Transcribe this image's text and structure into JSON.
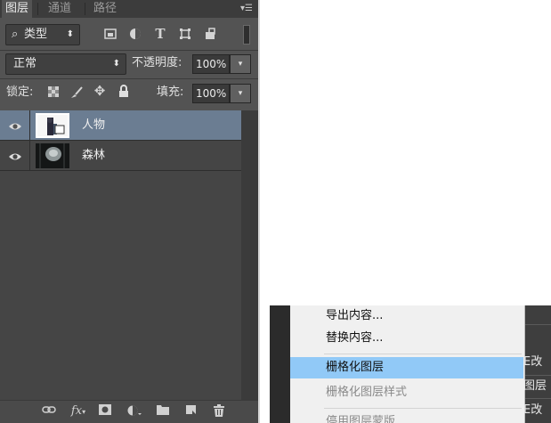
{
  "layers_panel": {
    "tabs": [
      "图层",
      "通道",
      "路径"
    ],
    "menu_icon": "panel-menu-icon",
    "filter": {
      "label": "类型",
      "icon": "search-icon"
    },
    "filter_icons": [
      "image-filter-icon",
      "adjustment-filter-icon",
      "type-filter-icon",
      "shape-filter-icon",
      "smart-object-filter-icon"
    ],
    "blend_mode": "正常",
    "opacity": {
      "label": "不透明度:",
      "value": "100%"
    },
    "lock": {
      "label": "锁定:",
      "icons": [
        "lock-transparent-icon",
        "lock-paint-icon",
        "lock-position-icon",
        "lock-all-icon"
      ]
    },
    "fill": {
      "label": "填充:",
      "value": "100%"
    },
    "layers": [
      {
        "name": "人物",
        "visible": true,
        "selected": true
      },
      {
        "name": "森林",
        "visible": true,
        "selected": false
      }
    ],
    "bottom_icons": [
      "link-icon",
      "fx-icon",
      "mask-icon",
      "adjustment-icon",
      "group-folder-icon",
      "new-layer-icon",
      "trash-icon"
    ],
    "fx_label": "fx"
  },
  "context_menu": {
    "items": [
      {
        "label": "导出内容...",
        "state": "normal"
      },
      {
        "label": "替换内容...",
        "state": "normal"
      },
      {
        "label": "栅格化图层",
        "state": "highlighted"
      },
      {
        "label": "栅格化图层样式",
        "state": "disabled"
      },
      {
        "label": "停用图层蒙版",
        "state": "disabled"
      }
    ]
  },
  "background_fragments": [
    "E改",
    "图层",
    "E改"
  ],
  "colors": {
    "panel": "#535353",
    "selected_layer": "#6b7d92",
    "menu_highlight": "#91c9f7"
  }
}
